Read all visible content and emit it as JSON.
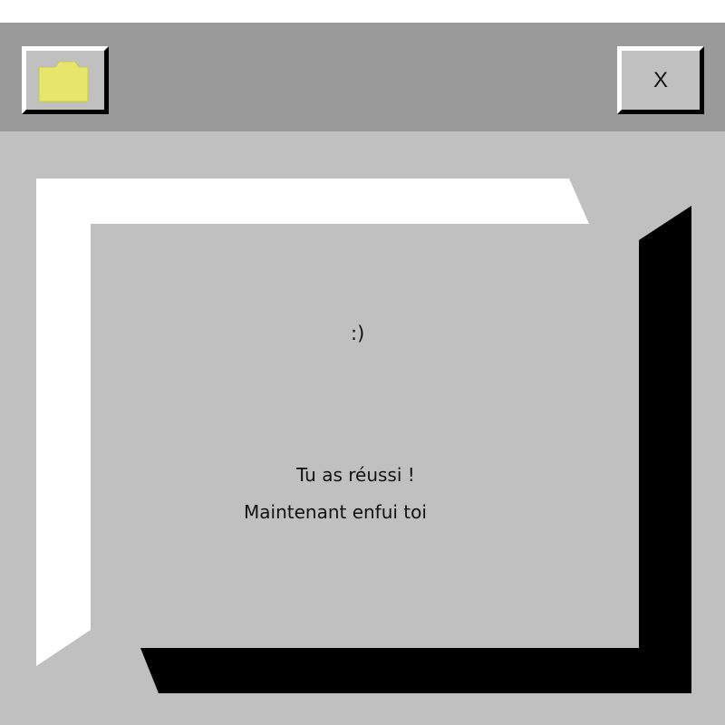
{
  "titlebar": {
    "folder_icon": "folder-icon",
    "close_label": "X"
  },
  "message": {
    "smiley": ":)",
    "line1": "Tu as réussi !",
    "line2": "Maintenant enfui toi"
  },
  "colors": {
    "window_bg": "#c0c0c0",
    "titlebar_bg": "#9a9a9a",
    "highlight": "#ffffff",
    "shadow": "#000000",
    "folder": "#e6e66a"
  }
}
